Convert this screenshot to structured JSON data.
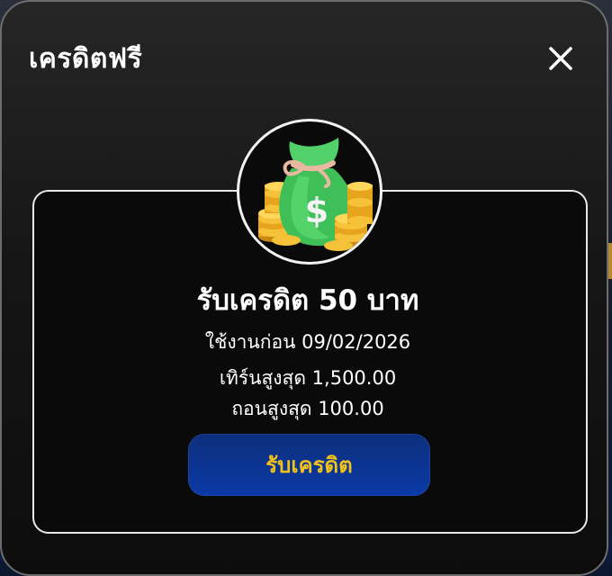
{
  "modal": {
    "title": "เครดิตฟรี",
    "close_icon": "close-icon"
  },
  "reward": {
    "icon": "money-bag-icon",
    "headline": "รับเครดิต 50 บาท",
    "use_before": "ใช้งานก่อน 09/02/2026",
    "max_turnover": "เทิร์นสูงสุด 1,500.00",
    "max_withdraw": "ถอนสูงสุด 100.00",
    "claim_label": "รับเครดิต"
  },
  "colors": {
    "accent_text": "#f1c21b",
    "button_bg": "#0a3aa6",
    "card_border": "#e8e8e8"
  }
}
